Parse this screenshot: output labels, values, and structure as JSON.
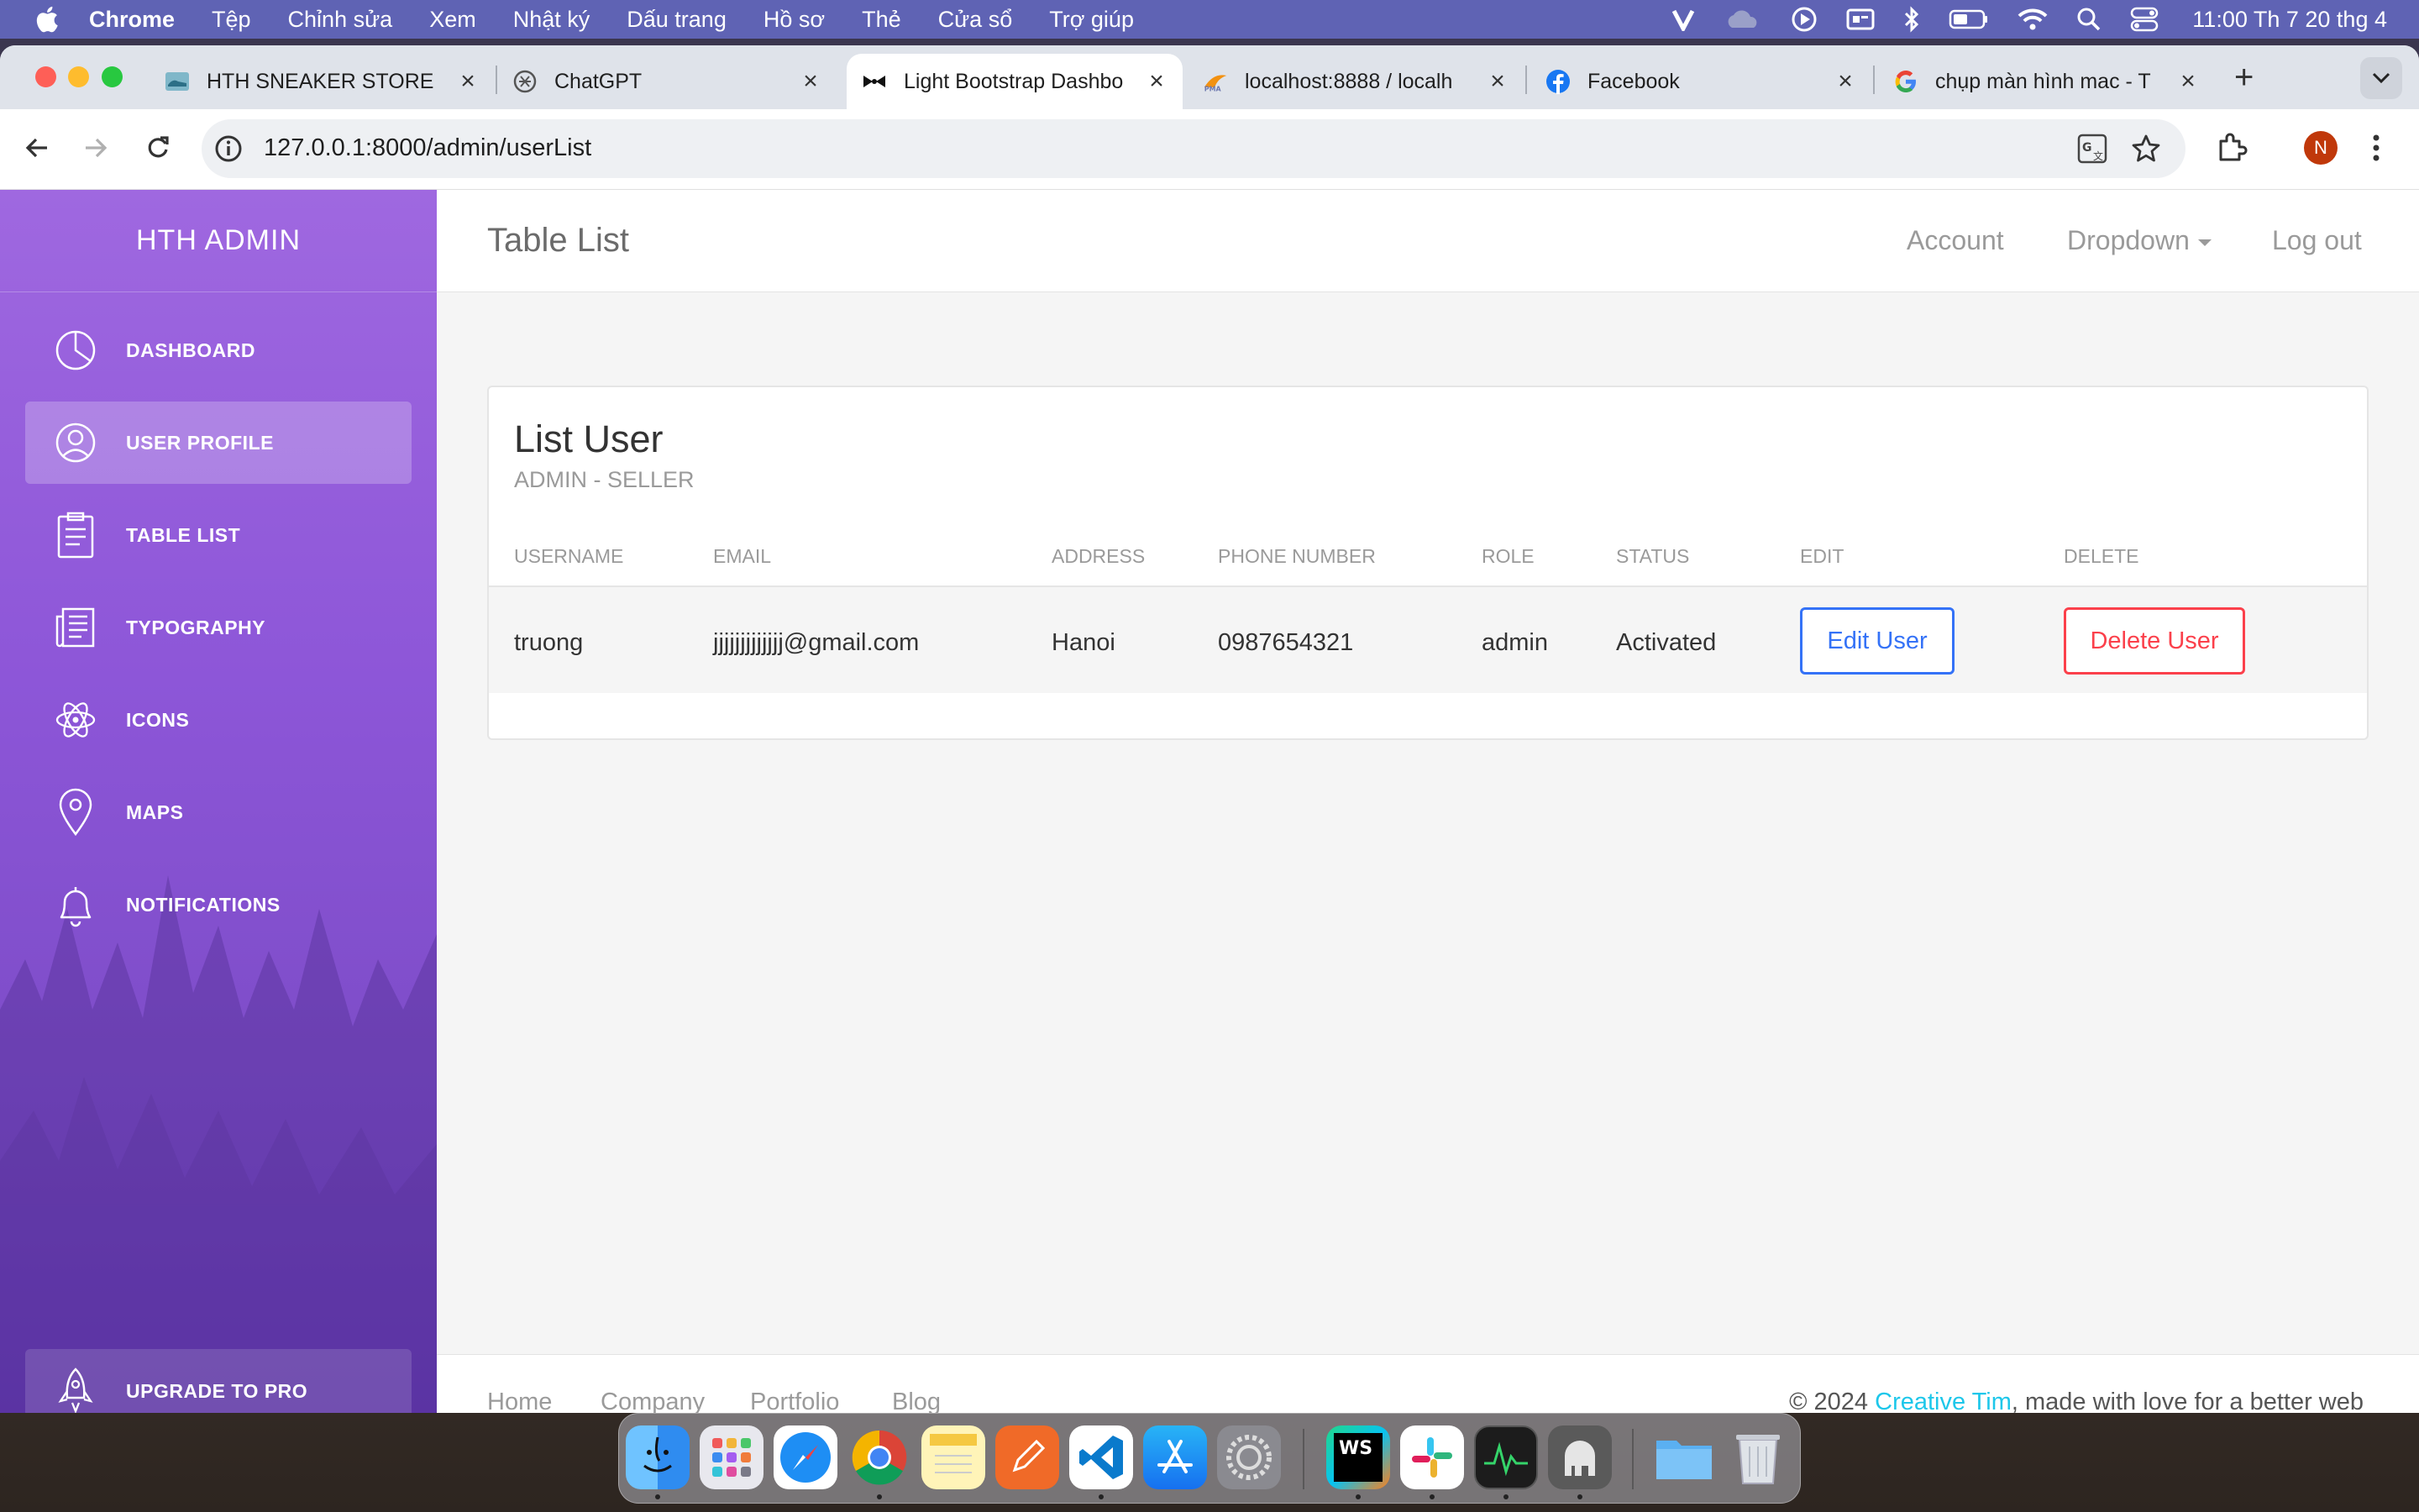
{
  "menubar": {
    "app": "Chrome",
    "items": [
      "Tệp",
      "Chỉnh sửa",
      "Xem",
      "Nhật ký",
      "Dấu trang",
      "Hồ sơ",
      "Thẻ",
      "Cửa sổ",
      "Trợ giúp"
    ],
    "clock": "11:00 Th 7 20 thg 4",
    "status_icons": [
      "v-icon",
      "cloud-icon",
      "play-circle-icon",
      "display-icon",
      "bluetooth-icon",
      "battery-icon",
      "wifi-icon",
      "search-icon",
      "control-center-icon"
    ]
  },
  "tabs": [
    {
      "title": "HTH SNEAKER STORE",
      "icon": "sneaker-favicon",
      "active": false
    },
    {
      "title": "ChatGPT",
      "icon": "chatgpt-favicon",
      "active": false
    },
    {
      "title": "Light Bootstrap Dashbo",
      "icon": "bowtie-favicon",
      "active": true
    },
    {
      "title": "localhost:8888 / localh",
      "icon": "phpmyadmin-favicon",
      "active": false
    },
    {
      "title": "Facebook",
      "icon": "facebook-favicon",
      "active": false
    },
    {
      "title": "chụp màn hình mac - T",
      "icon": "google-favicon",
      "active": false
    }
  ],
  "address_bar": {
    "url": "127.0.0.1:8000/admin/userList"
  },
  "profile_initial": "N",
  "sidebar": {
    "brand": "HTH ADMIN",
    "items": [
      {
        "label": "DASHBOARD",
        "icon": "pie-chart-icon",
        "active": false
      },
      {
        "label": "USER PROFILE",
        "icon": "user-circle-icon",
        "active": true
      },
      {
        "label": "TABLE LIST",
        "icon": "clipboard-icon",
        "active": false
      },
      {
        "label": "TYPOGRAPHY",
        "icon": "newspaper-icon",
        "active": false
      },
      {
        "label": "ICONS",
        "icon": "atom-icon",
        "active": false
      },
      {
        "label": "MAPS",
        "icon": "map-pin-icon",
        "active": false
      },
      {
        "label": "NOTIFICATIONS",
        "icon": "bell-icon",
        "active": false
      }
    ],
    "upgrade": "UPGRADE TO PRO"
  },
  "topnav": {
    "title": "Table List",
    "links": [
      "Account",
      "Dropdown",
      "Log out"
    ]
  },
  "card": {
    "title": "List User",
    "subtitle": "ADMIN - SELLER",
    "headers": [
      "USERNAME",
      "EMAIL",
      "ADDRESS",
      "PHONE NUMBER",
      "ROLE",
      "STATUS",
      "EDIT",
      "DELETE"
    ],
    "rows": [
      {
        "username": "truong",
        "email": "jjjjjjjjjjjjj@gmail.com",
        "address": "Hanoi",
        "phone": "0987654321",
        "role": "admin",
        "status": "Activated",
        "edit_label": "Edit User",
        "delete_label": "Delete User"
      }
    ]
  },
  "footer": {
    "links": [
      "Home",
      "Company",
      "Portfolio",
      "Blog"
    ],
    "copyright_prefix": "© 2024 ",
    "copyright_link": "Creative Tim",
    "copyright_suffix": ", made with love for a better web"
  },
  "dock": {
    "apps": [
      "finder",
      "launchpad",
      "safari",
      "chrome",
      "notes",
      "pencil-app",
      "vscode",
      "app-store",
      "system-settings",
      "webstorm",
      "slack",
      "activity-monitor",
      "tableplus",
      "folder",
      "trash"
    ],
    "webstorm_label": "WS"
  },
  "colors": {
    "sidebar_top": "#9f68e0",
    "sidebar_bottom": "#6d3fbf",
    "edit_button": "#3472f7",
    "delete_button": "#fb404b",
    "footer_link": "#1dc7ea",
    "menubar": "#5f63b4"
  }
}
